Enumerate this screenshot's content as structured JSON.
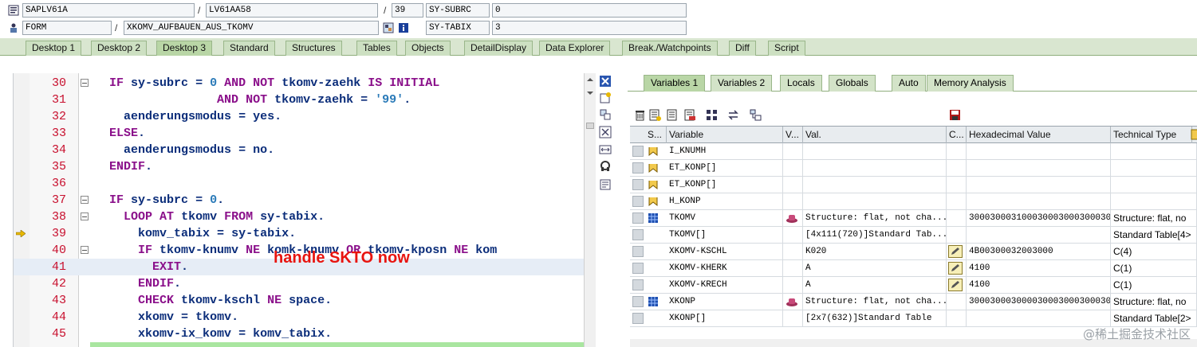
{
  "header": {
    "row1": {
      "program": "SAPLV61A",
      "include": "LV61AA58",
      "line": "39",
      "sysfield_name": "SY-SUBRC",
      "sysfield_value": "0"
    },
    "row2": {
      "event_type": "FORM",
      "event_name": "XKOMV_AUFBAUEN_AUS_TKOMV",
      "sysfield_name": "SY-TABIX",
      "sysfield_value": "3"
    }
  },
  "tabs": [
    "Desktop 1",
    "Desktop 2",
    "Desktop 3",
    "Standard",
    "Structures",
    "Tables",
    "Objects",
    "DetailDisplay",
    "Data Explorer",
    "Break./Watchpoints",
    "Diff",
    "Script"
  ],
  "active_tab": "Desktop 3",
  "editor": {
    "annotation": "handle SKTO now",
    "lines": [
      {
        "num": "30",
        "text": "IF sy-subrc = 0 AND NOT tkomv-zaehk IS INITIAL"
      },
      {
        "num": "31",
        "text": "               AND NOT tkomv-zaehk = '99'."
      },
      {
        "num": "32",
        "text": "  aenderungsmodus = yes."
      },
      {
        "num": "33",
        "text": "ELSE."
      },
      {
        "num": "34",
        "text": "  aenderungsmodus = no."
      },
      {
        "num": "35",
        "text": "ENDIF."
      },
      {
        "num": "36",
        "text": ""
      },
      {
        "num": "37",
        "text": "IF sy-subrc = 0."
      },
      {
        "num": "38",
        "text": "  LOOP AT tkomv FROM sy-tabix."
      },
      {
        "num": "39",
        "text": "    komv_tabix = sy-tabix."
      },
      {
        "num": "40",
        "text": "    IF tkomv-knumv NE komk-knumv OR tkomv-kposn NE kom"
      },
      {
        "num": "41",
        "text": "      EXIT."
      },
      {
        "num": "42",
        "text": "    ENDIF."
      },
      {
        "num": "43",
        "text": "    CHECK tkomv-kschl NE space."
      },
      {
        "num": "44",
        "text": "    xkomv = tkomv."
      },
      {
        "num": "45",
        "text": "    xkomv-ix_komv = komv_tabix."
      }
    ]
  },
  "right_tabs": [
    "Variables 1",
    "Variables 2",
    "Locals",
    "Globals",
    "Auto",
    "Memory Analysis"
  ],
  "right_active_tab": "Variables 1",
  "grid": {
    "columns": [
      "S...",
      "Variable",
      "V...",
      "Val.",
      "C...",
      "Hexadecimal Value",
      "Technical Type"
    ],
    "rows": [
      {
        "variable": "I_KNUMH",
        "value": "",
        "hex": "",
        "type": "",
        "icon": "param-icon",
        "edit": false,
        "struct": false
      },
      {
        "variable": "ET_KONP[]",
        "value": "",
        "hex": "",
        "type": "",
        "icon": "param-icon",
        "edit": false,
        "struct": false
      },
      {
        "variable": "ET_KONP[]",
        "value": "",
        "hex": "",
        "type": "",
        "icon": "param-icon",
        "edit": false,
        "struct": false
      },
      {
        "variable": "H_KONP",
        "value": "",
        "hex": "",
        "type": "",
        "icon": "param-icon",
        "edit": false,
        "struct": false
      },
      {
        "variable": "TKOMV",
        "value": "Structure: flat, not cha...",
        "hex": "30003000310003000300030003000...",
        "type": "Structure: flat, no",
        "icon": "structure-icon",
        "edit": false,
        "struct": true
      },
      {
        "variable": "TKOMV[]",
        "value": "[4x111(720)]Standard Tab...",
        "hex": "",
        "type": "Standard Table[4>",
        "icon": "",
        "edit": false,
        "struct": false
      },
      {
        "variable": "XKOMV-KSCHL",
        "value": "K020",
        "hex": "4B00300032003000",
        "type": "C(4)",
        "icon": "",
        "edit": true,
        "struct": false
      },
      {
        "variable": "XKOMV-KHERK",
        "value": "A",
        "hex": "4100",
        "type": "C(1)",
        "icon": "",
        "edit": true,
        "struct": false
      },
      {
        "variable": "XKOMV-KRECH",
        "value": "A",
        "hex": "4100",
        "type": "C(1)",
        "icon": "",
        "edit": true,
        "struct": false
      },
      {
        "variable": "XKONP",
        "value": "Structure: flat, not cha...",
        "hex": "30003000300003000300030003000...",
        "type": "Structure: flat, no",
        "icon": "structure-icon",
        "edit": false,
        "struct": true
      },
      {
        "variable": "XKONP[]",
        "value": "[2x7(632)]Standard Table",
        "hex": "",
        "type": "Standard Table[2>",
        "icon": "",
        "edit": false,
        "struct": false
      }
    ]
  },
  "watermark": "@稀土掘金技术社区",
  "colors": {
    "keyword": "#8a0f8a",
    "identifier": "#0b2d7a",
    "line_number": "#c8102e",
    "annotation": "#e8140f",
    "tab_bg": "#cde0c2"
  }
}
